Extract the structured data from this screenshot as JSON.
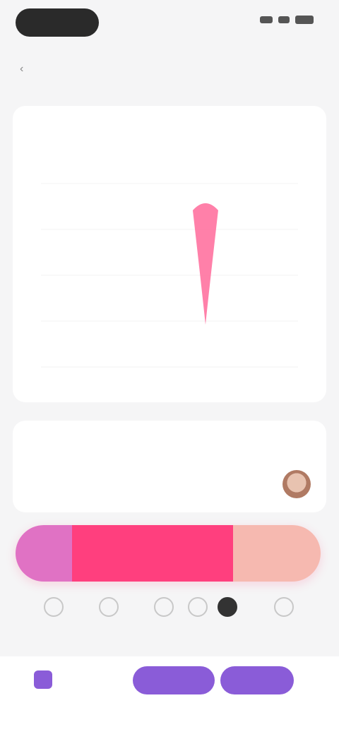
{
  "status_bar": {
    "time": "",
    "icons": [
      "signal-icon",
      "wifi-icon",
      "battery-icon"
    ]
  },
  "header": {
    "back_label": "",
    "title": ""
  },
  "chart_card": {
    "title": "",
    "subtitle": "",
    "note": ""
  },
  "chart_data": {
    "type": "area",
    "categories": [
      "",
      "",
      "",
      "",
      "",
      ""
    ],
    "series": [
      {
        "values": [
          0,
          0,
          0,
          90,
          0,
          0
        ],
        "color": "#ff6a9a"
      }
    ],
    "title": "",
    "xlabel": "",
    "ylabel": "",
    "ylim": [
      0,
      100
    ],
    "grid": true,
    "legend": "none"
  },
  "second_card": {
    "title": "",
    "subtitle": "",
    "note": ""
  },
  "cycle_bar": {
    "segments": [
      {
        "label": "",
        "color": "#e072c4"
      },
      {
        "label": "",
        "color": "#ff3f7e"
      },
      {
        "label": "",
        "color": "#f6b9b0"
      }
    ]
  },
  "tabs": [
    {
      "label": "",
      "active": false
    },
    {
      "label": "",
      "active": false
    },
    {
      "label": "",
      "active": false
    },
    {
      "label": "",
      "active": false
    },
    {
      "label": "",
      "active": true
    },
    {
      "label": "",
      "active": false
    }
  ],
  "bottom_panel": {
    "legend_text": "",
    "button_1": "",
    "button_2": "",
    "accent": "#8a5cd8"
  }
}
